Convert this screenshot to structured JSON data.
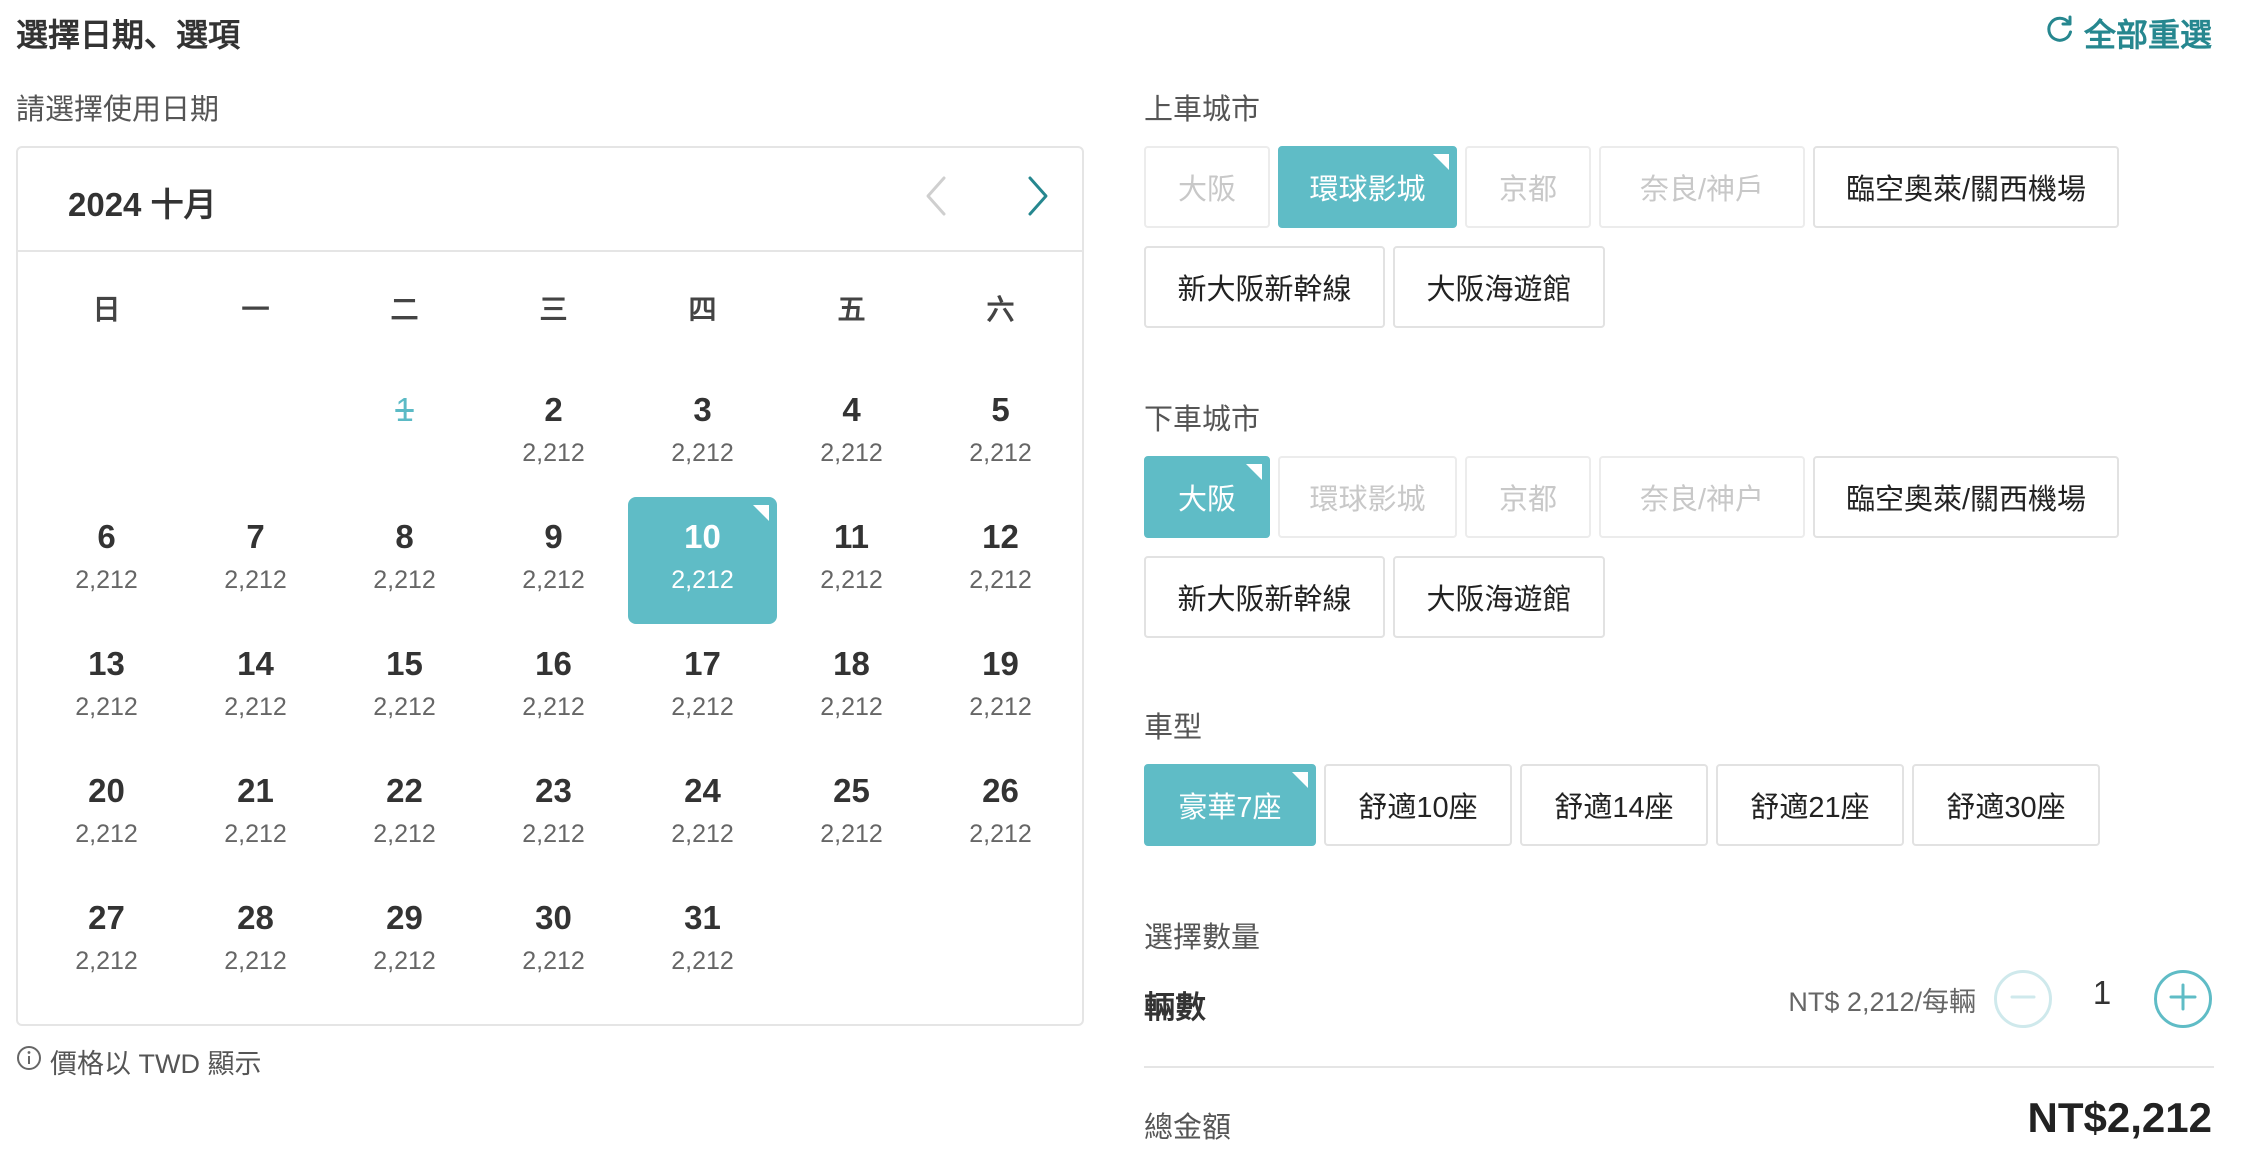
{
  "header": {
    "title": "選擇日期、選項",
    "reset_label": "全部重選"
  },
  "calendar": {
    "prompt": "請選擇使用日期",
    "month_label": "2024 十月",
    "weekdays": [
      "日",
      "一",
      "二",
      "三",
      "四",
      "五",
      "六"
    ],
    "leading_blanks": 2,
    "days": [
      {
        "day": "1",
        "price": "",
        "state": "disabled"
      },
      {
        "day": "2",
        "price": "2,212",
        "state": "available"
      },
      {
        "day": "3",
        "price": "2,212",
        "state": "available"
      },
      {
        "day": "4",
        "price": "2,212",
        "state": "available"
      },
      {
        "day": "5",
        "price": "2,212",
        "state": "available"
      },
      {
        "day": "6",
        "price": "2,212",
        "state": "available"
      },
      {
        "day": "7",
        "price": "2,212",
        "state": "available"
      },
      {
        "day": "8",
        "price": "2,212",
        "state": "available"
      },
      {
        "day": "9",
        "price": "2,212",
        "state": "available"
      },
      {
        "day": "10",
        "price": "2,212",
        "state": "selected"
      },
      {
        "day": "11",
        "price": "2,212",
        "state": "available"
      },
      {
        "day": "12",
        "price": "2,212",
        "state": "available"
      },
      {
        "day": "13",
        "price": "2,212",
        "state": "available"
      },
      {
        "day": "14",
        "price": "2,212",
        "state": "available"
      },
      {
        "day": "15",
        "price": "2,212",
        "state": "available"
      },
      {
        "day": "16",
        "price": "2,212",
        "state": "available"
      },
      {
        "day": "17",
        "price": "2,212",
        "state": "available"
      },
      {
        "day": "18",
        "price": "2,212",
        "state": "available"
      },
      {
        "day": "19",
        "price": "2,212",
        "state": "available"
      },
      {
        "day": "20",
        "price": "2,212",
        "state": "available"
      },
      {
        "day": "21",
        "price": "2,212",
        "state": "available"
      },
      {
        "day": "22",
        "price": "2,212",
        "state": "available"
      },
      {
        "day": "23",
        "price": "2,212",
        "state": "available"
      },
      {
        "day": "24",
        "price": "2,212",
        "state": "available"
      },
      {
        "day": "25",
        "price": "2,212",
        "state": "available"
      },
      {
        "day": "26",
        "price": "2,212",
        "state": "available"
      },
      {
        "day": "27",
        "price": "2,212",
        "state": "available"
      },
      {
        "day": "28",
        "price": "2,212",
        "state": "available"
      },
      {
        "day": "29",
        "price": "2,212",
        "state": "available"
      },
      {
        "day": "30",
        "price": "2,212",
        "state": "available"
      },
      {
        "day": "31",
        "price": "2,212",
        "state": "available"
      }
    ],
    "currency_note": "價格以 TWD 顯示"
  },
  "pickup": {
    "label": "上車城市",
    "options": [
      {
        "label": "大阪",
        "state": "disabled"
      },
      {
        "label": "環球影城",
        "state": "active"
      },
      {
        "label": "京都",
        "state": "disabled"
      },
      {
        "label": "奈良/神戶",
        "state": "disabled"
      },
      {
        "label": "臨空奧萊/關西機場",
        "state": "available"
      },
      {
        "label": "新大阪新幹線",
        "state": "available"
      },
      {
        "label": "大阪海遊館",
        "state": "available"
      }
    ]
  },
  "dropoff": {
    "label": "下車城市",
    "options": [
      {
        "label": "大阪",
        "state": "active"
      },
      {
        "label": "環球影城",
        "state": "disabled"
      },
      {
        "label": "京都",
        "state": "disabled"
      },
      {
        "label": "奈良/神户",
        "state": "disabled"
      },
      {
        "label": "臨空奧萊/關西機場",
        "state": "available"
      },
      {
        "label": "新大阪新幹線",
        "state": "available"
      },
      {
        "label": "大阪海遊館",
        "state": "available"
      }
    ]
  },
  "vehicle": {
    "label": "車型",
    "options": [
      {
        "label": "豪華7座",
        "state": "active"
      },
      {
        "label": "舒適10座",
        "state": "available"
      },
      {
        "label": "舒適14座",
        "state": "available"
      },
      {
        "label": "舒適21座",
        "state": "available"
      },
      {
        "label": "舒適30座",
        "state": "available"
      }
    ]
  },
  "quantity": {
    "section_label": "選擇數量",
    "item_label": "輛數",
    "unit_price": "NT$ 2,212/每輛",
    "value": "1"
  },
  "total": {
    "label": "總金額",
    "value": "NT$2,212"
  },
  "colors": {
    "accent": "#5fbcc6",
    "accent_dark": "#26878f"
  },
  "icons": {
    "reset": "refresh-icon",
    "prev": "chevron-left-icon",
    "next": "chevron-right-icon",
    "info": "info-icon",
    "minus": "minus-icon",
    "plus": "plus-icon"
  }
}
